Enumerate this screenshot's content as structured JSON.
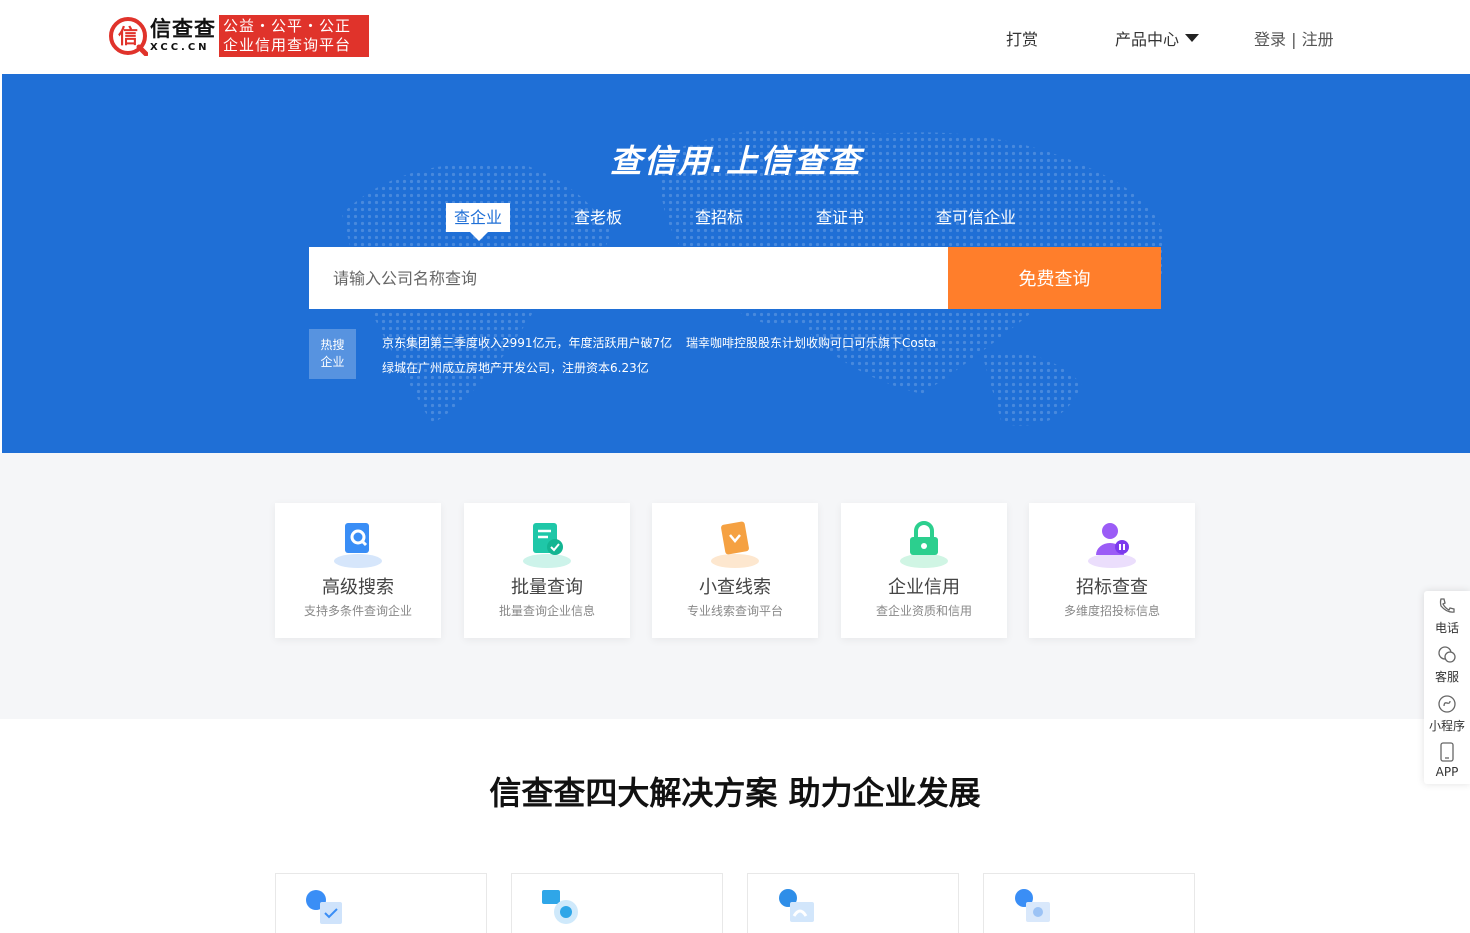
{
  "header": {
    "logo_name": "信查查",
    "logo_domain": "XCC.CN",
    "slogan_line1": "公益・公平・公正",
    "slogan_line2": "企业信用查询平台",
    "nav_reward": "打赏",
    "nav_products": "产品中心",
    "nav_auth": "登录 | 注册"
  },
  "hero": {
    "title": "查信用.上信查查",
    "tabs": [
      "查企业",
      "查老板",
      "查招标",
      "查证书",
      "查可信企业"
    ],
    "search_placeholder": "请输入公司名称查询",
    "search_button": "免费查询",
    "hot_label_1": "热搜",
    "hot_label_2": "企业",
    "hot_items": [
      "京东集团第三季度收入2991亿元，年度活跃用户破7亿",
      "瑞幸咖啡控股股东计划收购可口可乐旗下Costa",
      "绿城在广州成立房地产开发公司，注册资本6.23亿"
    ]
  },
  "features": [
    {
      "title": "高级搜索",
      "subtitle": "支持多条件查询企业",
      "icon": "search-doc-icon",
      "color": "#3a8ef6"
    },
    {
      "title": "批量查询",
      "subtitle": "批量查询企业信息",
      "icon": "batch-doc-icon",
      "color": "#1fc7a8"
    },
    {
      "title": "小查线索",
      "subtitle": "专业线索查询平台",
      "icon": "clue-folder-icon",
      "color": "#f5a142"
    },
    {
      "title": "企业信用",
      "subtitle": "查企业资质和信用",
      "icon": "credit-lock-icon",
      "color": "#2ccf8e"
    },
    {
      "title": "招标查查",
      "subtitle": "多维度招投标信息",
      "icon": "bid-user-icon",
      "color": "#9b5cf6"
    }
  ],
  "solutions": {
    "title": "信查查四大解决方案 助力企业发展"
  },
  "sidebar": {
    "phone": "电话",
    "service": "客服",
    "mini": "小程序",
    "app": "APP"
  },
  "colors": {
    "brand_blue": "#1f6fd6",
    "brand_red": "#e0332b",
    "search_orange": "#ff7e2b"
  }
}
